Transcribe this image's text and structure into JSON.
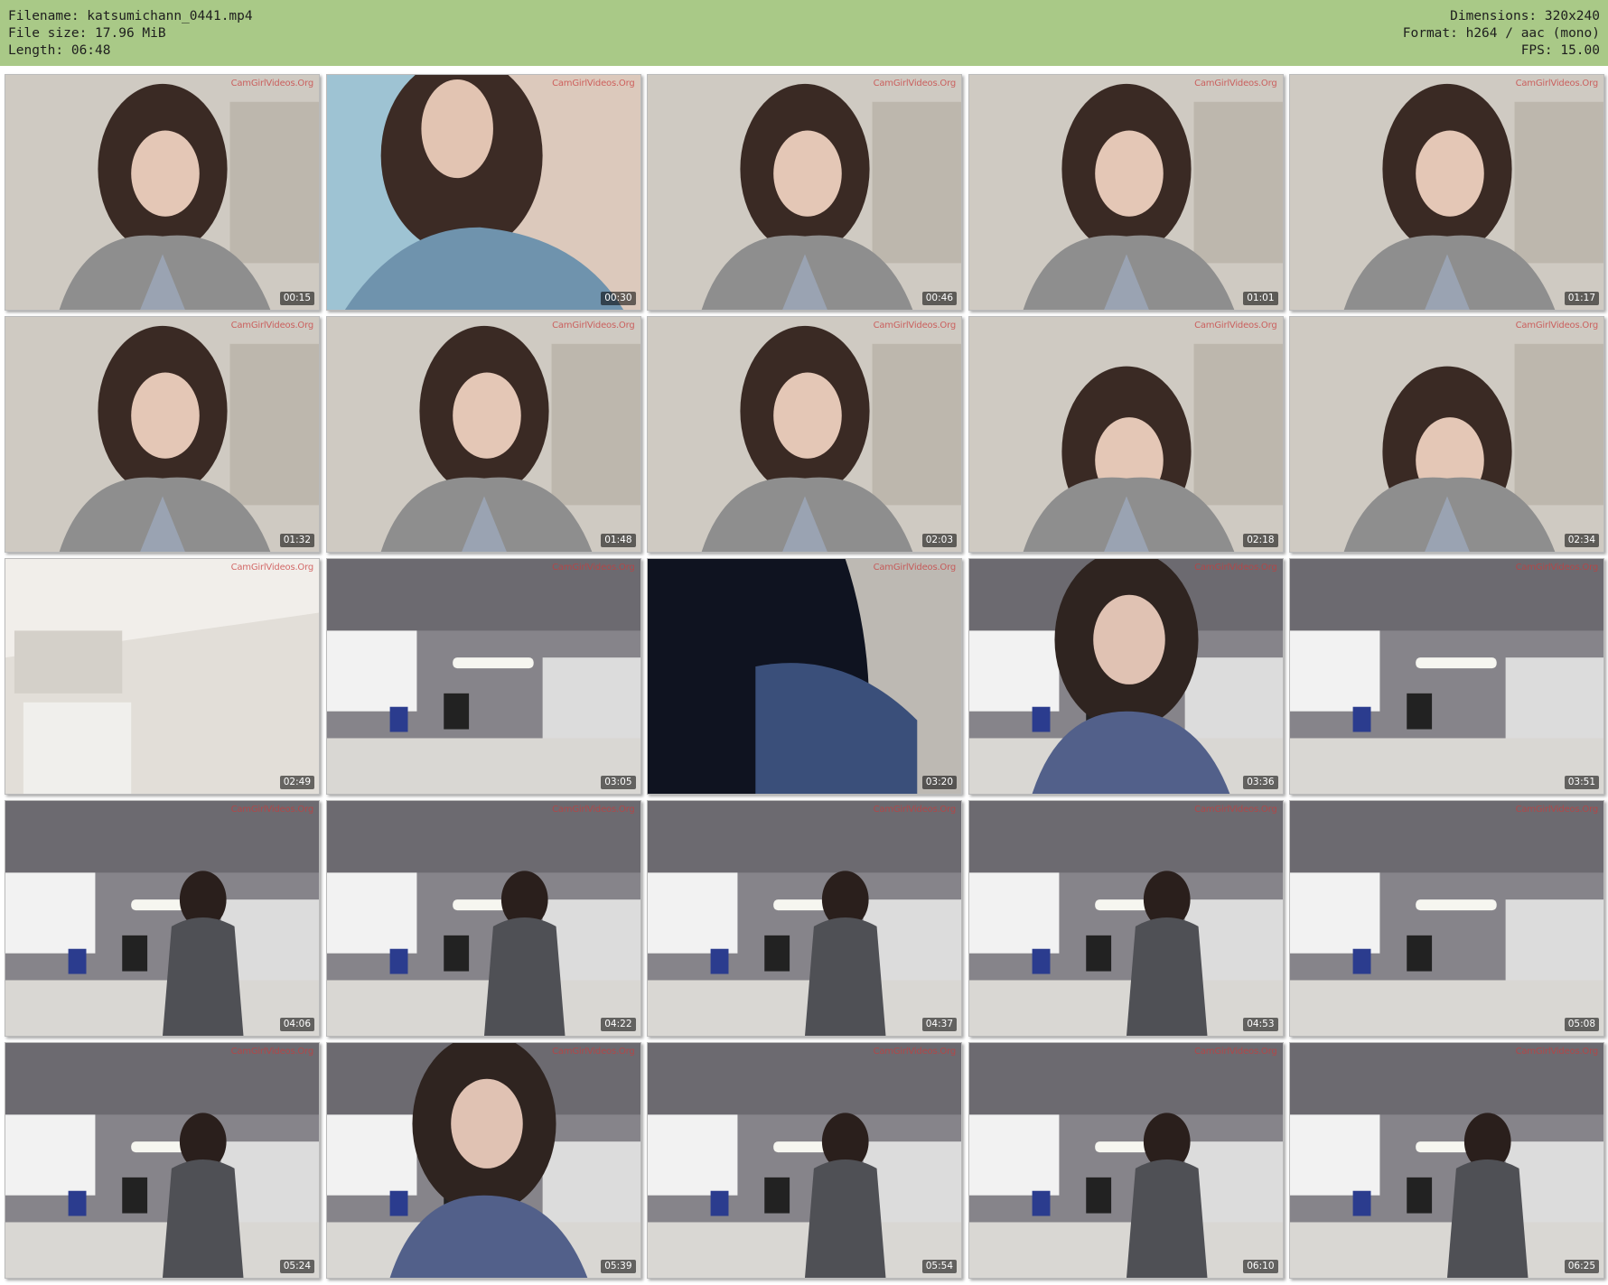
{
  "header": {
    "filename": "Filename: katsumichann_0441.mp4",
    "filesize": "File size: 17.96 MiB",
    "length": "Length: 06:48",
    "dimensions": "Dimensions: 320x240",
    "format": "Format: h264 / aac (mono)",
    "fps": "FPS: 15.00"
  },
  "watermark": "CamGirlVideos.Org",
  "colors": {
    "header_bg": "#a9c987",
    "page_bg": "#ffffff"
  },
  "thumbnails": [
    {
      "time": "00:15",
      "scene": "face"
    },
    {
      "time": "00:30",
      "scene": "face-blue"
    },
    {
      "time": "00:46",
      "scene": "face"
    },
    {
      "time": "01:01",
      "scene": "face"
    },
    {
      "time": "01:17",
      "scene": "face"
    },
    {
      "time": "01:32",
      "scene": "face"
    },
    {
      "time": "01:48",
      "scene": "face"
    },
    {
      "time": "02:03",
      "scene": "face"
    },
    {
      "time": "02:18",
      "scene": "face-low"
    },
    {
      "time": "02:34",
      "scene": "face-low"
    },
    {
      "time": "02:49",
      "scene": "room"
    },
    {
      "time": "03:05",
      "scene": "kitchen"
    },
    {
      "time": "03:20",
      "scene": "dark"
    },
    {
      "time": "03:36",
      "scene": "face-kitchen"
    },
    {
      "time": "03:51",
      "scene": "kitchen"
    },
    {
      "time": "04:06",
      "scene": "kitchen-person"
    },
    {
      "time": "04:22",
      "scene": "kitchen-person"
    },
    {
      "time": "04:37",
      "scene": "kitchen-person"
    },
    {
      "time": "04:53",
      "scene": "kitchen-person"
    },
    {
      "time": "05:08",
      "scene": "kitchen"
    },
    {
      "time": "05:24",
      "scene": "kitchen-person"
    },
    {
      "time": "05:39",
      "scene": "face-kitchen"
    },
    {
      "time": "05:54",
      "scene": "kitchen-person"
    },
    {
      "time": "06:10",
      "scene": "kitchen-person"
    },
    {
      "time": "06:25",
      "scene": "kitchen-person"
    }
  ]
}
